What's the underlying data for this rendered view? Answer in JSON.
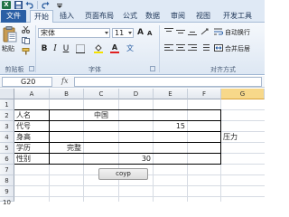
{
  "quick_access": {
    "excel_logo": "X"
  },
  "tabs": [
    {
      "label": "文件"
    },
    {
      "label": "开始"
    },
    {
      "label": "插入"
    },
    {
      "label": "页面布局"
    },
    {
      "label": "公式"
    },
    {
      "label": "数据"
    },
    {
      "label": "审阅"
    },
    {
      "label": "视图"
    },
    {
      "label": "开发工具"
    }
  ],
  "ribbon": {
    "clipboard": {
      "paste_label": "粘贴",
      "group_label": "剪贴板"
    },
    "font": {
      "font_name": "宋体",
      "font_size": "11",
      "bold": "B",
      "italic": "I",
      "underline": "U",
      "group_label": "字体",
      "grow": "A",
      "shrink": "A",
      "font_color_letter": "A",
      "phonetic": "文"
    },
    "alignment": {
      "wrap_text": "自动换行",
      "merge_center": "合并后居",
      "group_label": "对齐方式"
    }
  },
  "formula_bar": {
    "name_box": "G20",
    "fx": "fx",
    "formula": ""
  },
  "columns": [
    "A",
    "B",
    "C",
    "D",
    "E",
    "F",
    "G"
  ],
  "selected_column": "G",
  "rows": [
    "1",
    "2",
    "3",
    "4",
    "5",
    "6",
    "7",
    "8",
    "9",
    "10"
  ],
  "cells": {
    "A2": "人名",
    "C2": "中国",
    "A3": "代号",
    "E3": "15",
    "A4": "身高",
    "G4": "压力",
    "A5": "学历",
    "B5": "完整",
    "A6": "性别",
    "D6": "30"
  },
  "copy_button": {
    "label": "coyp"
  },
  "colors": {
    "file_tab": "#2a5fa5",
    "selected_header": "#f7d88a",
    "excel_green": "#1e7145"
  }
}
